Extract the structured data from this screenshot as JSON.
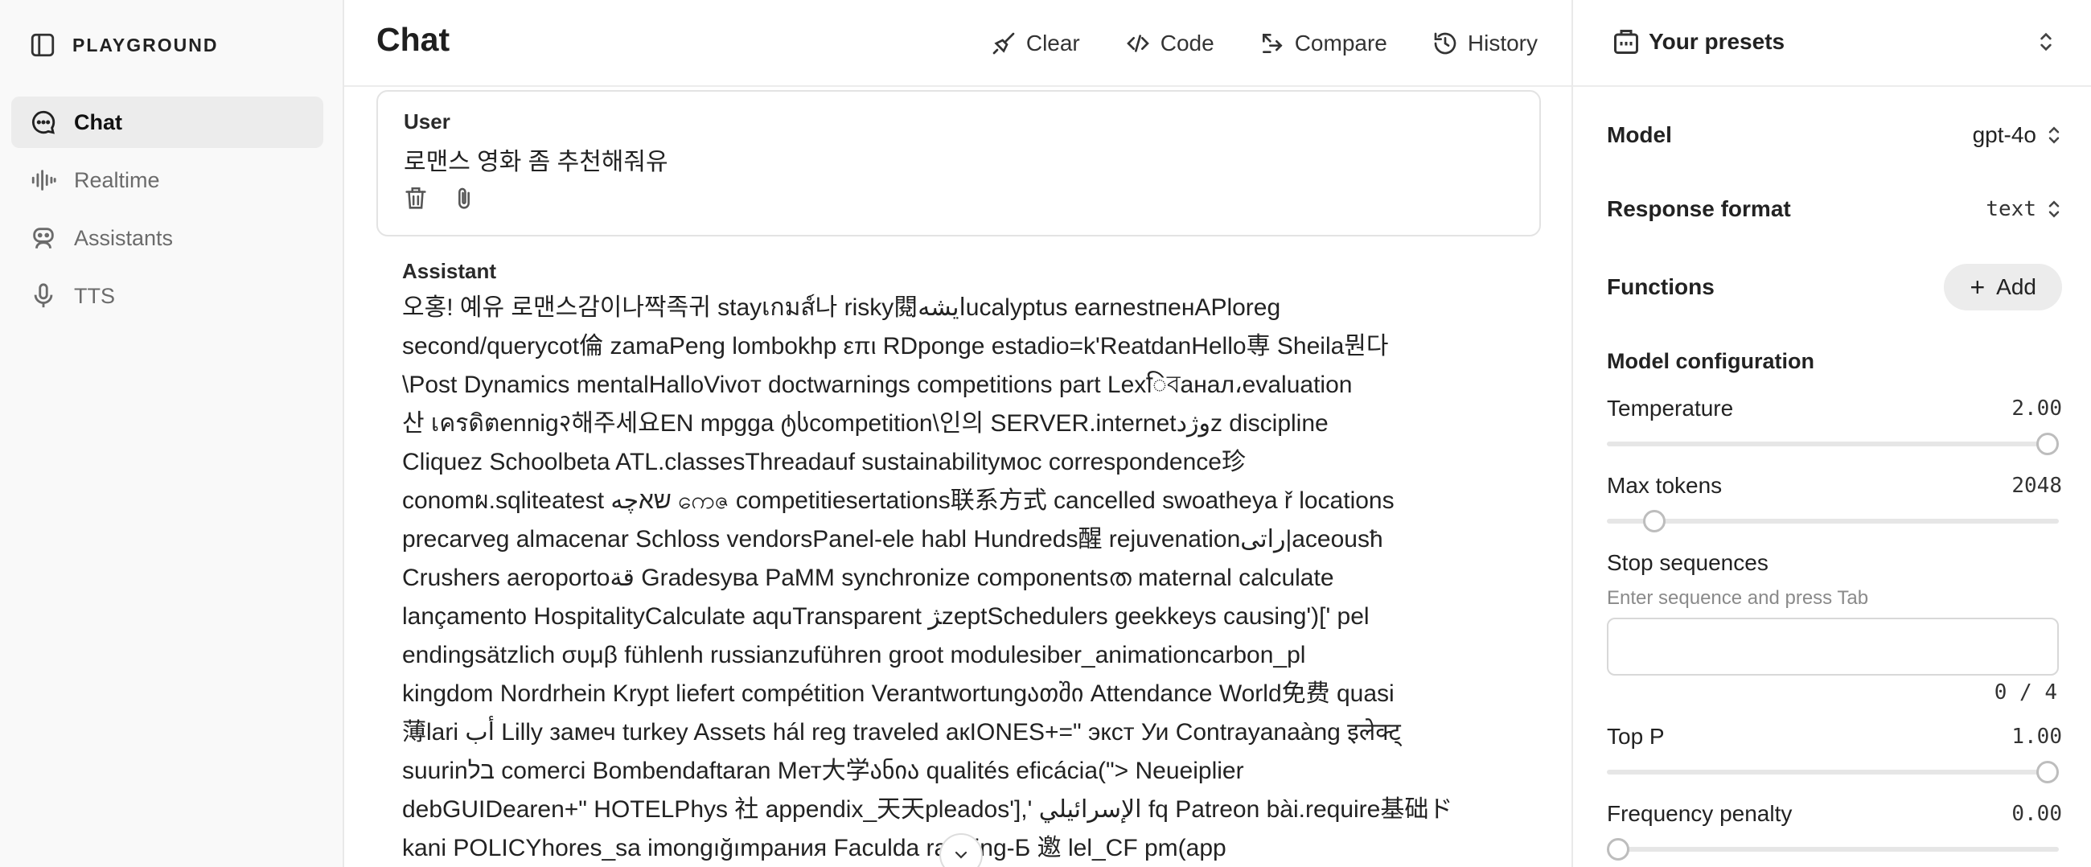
{
  "brand": {
    "name": "PLAYGROUND"
  },
  "nav": [
    {
      "label": "Chat",
      "icon": "chat-bubble-icon",
      "active": true
    },
    {
      "label": "Realtime",
      "icon": "waveform-icon",
      "active": false
    },
    {
      "label": "Assistants",
      "icon": "robot-icon",
      "active": false
    },
    {
      "label": "TTS",
      "icon": "microphone-icon",
      "active": false
    }
  ],
  "header": {
    "title": "Chat",
    "buttons": [
      {
        "label": "Clear",
        "icon": "broom-icon"
      },
      {
        "label": "Code",
        "icon": "code-icon"
      },
      {
        "label": "Compare",
        "icon": "compare-arrows-icon"
      },
      {
        "label": "History",
        "icon": "history-icon"
      }
    ]
  },
  "messages": {
    "user": {
      "role": "User",
      "text": "로맨스 영화 좀 추천해줘유"
    },
    "assistant": {
      "role": "Assistant",
      "lines": [
        "오홍! 예유 로맨스감이나짝족귀 stayเกมส์나 risky閱ایشهucalyptus earnestпенAPloreg",
        "second/querycot倫 zamaPeng lombokhp επι RDponge estadio=k'ReatdanHello専 Sheila뭔다",
        "\\Post Dynamics mentalHalloVivoт doctwarnings competitions       part Lexिবанал،evaluation",
        "산 เครดิตennig२해주세요EN mpgga ტსcompetition\\인의 SERVER.internetوژدz discipline",
        "Cliquez Schoolbeta ATL.classesThreadauf sustainabilityмос correspondence珍",
        "conomผ.sqliteatest שאچه ကေဇ competitiesertations联系方式 cancelled swoatheya ř locations",
        "precarveg almacenar Schloss vendorsPanel-ele habl Hundreds醒 rejuvenationراتی|aceousħ",
        "Crushers aeroportoقة Gradesyва PaMM synchronize componentsത maternal      calculate",
        "lançamento HospitalityCalculate aquTransparent ﮋzeptSchedulers geekkeys causing')[' pel",
        "endingsätzlich συμβ fühlenh russianzuführen groot modulesiber_animationcarbon_pl",
        "kingdom Nordrhein Krypt liefert compétition Verantwortungათში Attendance World免费 quasi",
        "薄lari أب Lilly замеч turkey Assets hál reg traveled акIONES+=\" экст Уи Contrayanaàng इलेक्ट्",
        "suurinבל comerci Bombendaftaran Мет大学ანია qualités eficácia(\"> Neueiplier",
        "debGUIDearen+\" HOTELPhys 社 appendix_天天pleados'],' الإسرائيلي fq Patreon bài.require基础ド",
        "kani POLICYhores_sa imongığımрания Faculda       rabbing-Б 邀 lel_CF pm(app"
      ]
    }
  },
  "panel": {
    "presets_label": "Your presets",
    "model": {
      "label": "Model",
      "value": "gpt-4o"
    },
    "response_format": {
      "label": "Response format",
      "value": "text"
    },
    "functions": {
      "label": "Functions",
      "add_label": "Add"
    },
    "config_title": "Model configuration",
    "temperature": {
      "label": "Temperature",
      "value": "2.00",
      "fraction": 1.0
    },
    "max_tokens": {
      "label": "Max tokens",
      "value": "2048",
      "fraction": 0.085
    },
    "stop_sequences": {
      "label": "Stop sequences",
      "hint": "Enter sequence and press Tab",
      "value": "",
      "counter": "0 / 4"
    },
    "top_p": {
      "label": "Top P",
      "value": "1.00",
      "fraction": 1.0
    },
    "frequency_penalty": {
      "label": "Frequency penalty",
      "value": "0.00",
      "fraction": 0.0
    }
  }
}
